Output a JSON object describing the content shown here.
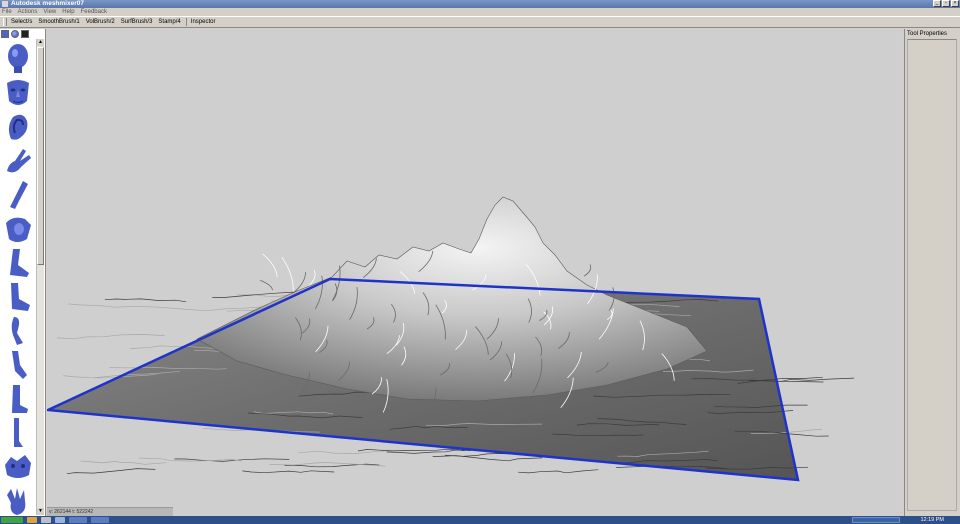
{
  "window": {
    "title": "Autodesk meshmixer07"
  },
  "menubar": {
    "items": [
      "File",
      "Actions",
      "View",
      "Help",
      "Feedback"
    ]
  },
  "toolbar": {
    "select": "Select/s",
    "smooth": "SmoothBrush/1",
    "vol": "VolBrush/2",
    "surf": "SurfBrush/3",
    "stamp": "Stamp/4",
    "inspector": "Inspector"
  },
  "palette": {
    "tabs": [
      "meshes-tab",
      "sphere-tab",
      "material-tab"
    ],
    "items": [
      "head-bald",
      "face",
      "ear",
      "hand-peace",
      "arm",
      "torso",
      "leg-bent",
      "foot-heel",
      "leg-small",
      "leg-thin",
      "boot",
      "leg-long",
      "creature-head",
      "hand-claw"
    ]
  },
  "viewport": {
    "status": "v: 262144 t: 522242"
  },
  "rightpanel": {
    "title": "Tool Properties"
  },
  "taskbar": {
    "clock": "12:19 PM"
  },
  "colors": {
    "plane_edge": "#1f33c8",
    "mesh_light": "#f0f0f0",
    "mesh_dark": "#4a4a4a",
    "background": "#cfcfcf",
    "palette_blue": "#4a5dc4"
  }
}
